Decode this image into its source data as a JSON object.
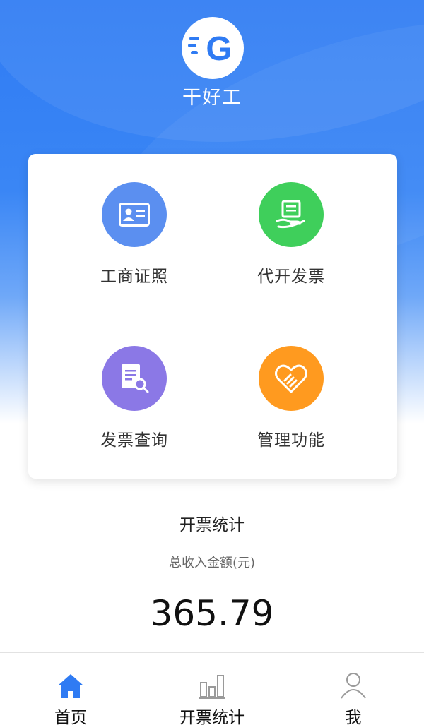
{
  "app": {
    "title": "干好工",
    "logo_letter": "G"
  },
  "colors": {
    "header_blue": "#2f7bf3",
    "license_blue": "#5b8ff0",
    "invoice_green": "#3fcf5b",
    "query_purple": "#8b78e6",
    "manage_orange": "#ff9a1f",
    "tab_active_blue": "#2f7bf3"
  },
  "menu": {
    "items": [
      {
        "label": "工商证照",
        "icon": "id-card-icon"
      },
      {
        "label": "代开发票",
        "icon": "invoice-hand-icon"
      },
      {
        "label": "发票查询",
        "icon": "document-search-icon"
      },
      {
        "label": "管理功能",
        "icon": "heart-handshake-icon"
      }
    ]
  },
  "stats": {
    "title": "开票统计",
    "subtitle": "总收入金额(元)",
    "amount": "365.79"
  },
  "tabbar": {
    "items": [
      {
        "label": "首页",
        "icon": "home-icon",
        "active": true
      },
      {
        "label": "开票统计",
        "icon": "bar-chart-icon",
        "active": false
      },
      {
        "label": "我",
        "icon": "user-icon",
        "active": false
      }
    ]
  }
}
